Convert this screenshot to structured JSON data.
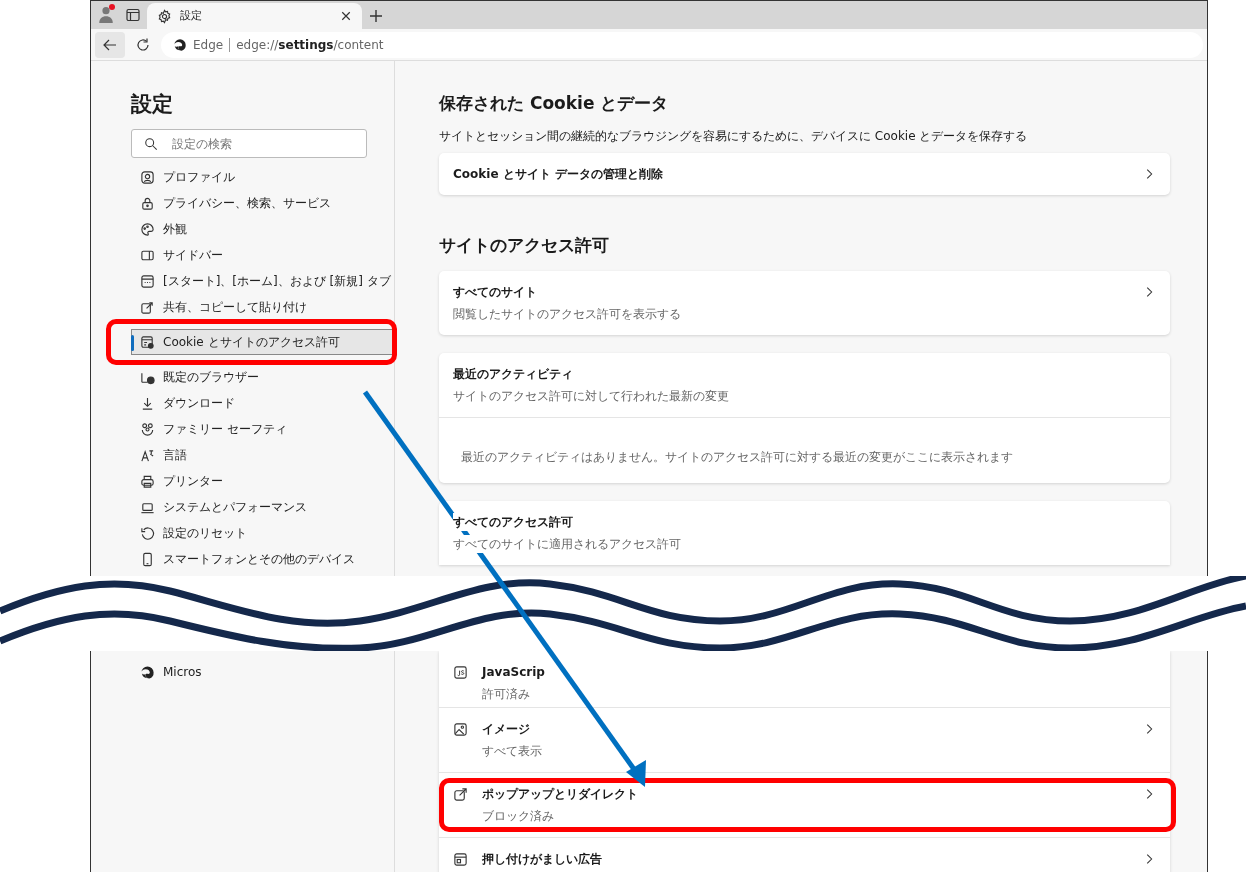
{
  "browser": {
    "tab_title": "設定",
    "address_brand": "Edge",
    "url": "edge://**settings**/content",
    "profile_notification": true
  },
  "sidebar": {
    "title": "設定",
    "search": {
      "placeholder": "設定の検索"
    },
    "items": [
      {
        "label": "プロファイル",
        "selected": false,
        "highlighted": false
      },
      {
        "label": "プライバシー、検索、サービス",
        "selected": false,
        "highlighted": false
      },
      {
        "label": "外観",
        "selected": false,
        "highlighted": false
      },
      {
        "label": "サイドバー",
        "selected": false,
        "highlighted": false
      },
      {
        "label": "[スタート]、[ホーム]、および [新規] タブ",
        "selected": false,
        "highlighted": false
      },
      {
        "label": "共有、コピーして貼り付け",
        "selected": false,
        "highlighted": false
      },
      {
        "label": "Cookie とサイトのアクセス許可",
        "selected": true,
        "highlighted": true
      },
      {
        "label": "既定のブラウザー",
        "selected": false,
        "highlighted": false
      },
      {
        "label": "ダウンロード",
        "selected": false,
        "highlighted": false
      },
      {
        "label": "ファミリー セーフティ",
        "selected": false,
        "highlighted": false
      },
      {
        "label": "言語",
        "selected": false,
        "highlighted": false
      },
      {
        "label": "プリンター",
        "selected": false,
        "highlighted": false
      },
      {
        "label": "システムとパフォーマンス",
        "selected": false,
        "highlighted": false
      },
      {
        "label": "設定のリセット",
        "selected": false,
        "highlighted": false
      },
      {
        "label": "スマートフォンとその他のデバイス",
        "selected": false,
        "highlighted": false
      }
    ],
    "items_after_break": [
      {
        "label": "Micros",
        "selected": false,
        "highlighted": false
      }
    ]
  },
  "main": {
    "sections": [
      {
        "heading": "保存された Cookie とデータ",
        "description": "サイトとセッション間の継続的なブラウジングを容易にするために、デバイスに Cookie とデータを保存する",
        "cards": [
          {
            "kind": "link",
            "title": "Cookie とサイト データの管理と削除"
          }
        ]
      },
      {
        "heading": "サイトのアクセス許可",
        "cards": [
          {
            "kind": "link",
            "title": "すべてのサイト",
            "subtitle": "閲覧したサイトのアクセス許可を表示する"
          },
          {
            "kind": "activity",
            "title": "最近のアクティビティ",
            "subtitle": "サイトのアクセス許可に対して行われた最新の変更",
            "message": "最近のアクティビティはありません。サイトのアクセス許可に対する最近の変更がここに表示されます"
          },
          {
            "kind": "group",
            "title": "すべてのアクセス許可",
            "subtitle": "すべてのサイトに適用されるアクセス許可"
          }
        ]
      }
    ],
    "rows_after_break": [
      {
        "title": "JavaScrip",
        "subtitle": "許可済み",
        "chevron": false,
        "highlighted": false
      },
      {
        "title": "イメージ",
        "subtitle": "すべて表示",
        "chevron": true,
        "highlighted": false
      },
      {
        "title": "ポップアップとリダイレクト",
        "subtitle": "ブロック済み",
        "chevron": true,
        "highlighted": true
      },
      {
        "title": "押し付けがましい広告",
        "chevron": true,
        "highlighted": false
      }
    ]
  }
}
